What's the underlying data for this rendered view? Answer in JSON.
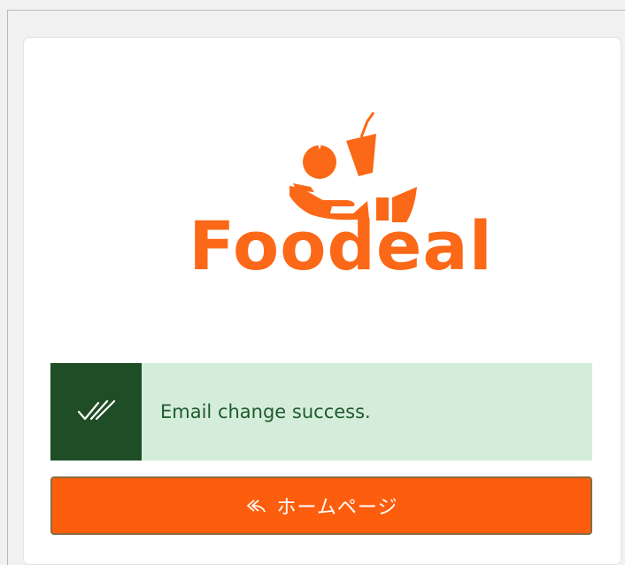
{
  "logo": {
    "brand_name": "Foodeal",
    "icon": "food-hand-logo-icon",
    "color": "#fb6817"
  },
  "alert": {
    "type": "success",
    "icon": "double-check-icon",
    "message": "Email change success.",
    "colors": {
      "icon_bg": "#1f4d25",
      "bg": "#d4eddb",
      "text": "#1f5a2b"
    }
  },
  "home_button": {
    "icon": "reply-all-icon",
    "label": "ホームページ",
    "color": "#fd5e0e"
  }
}
